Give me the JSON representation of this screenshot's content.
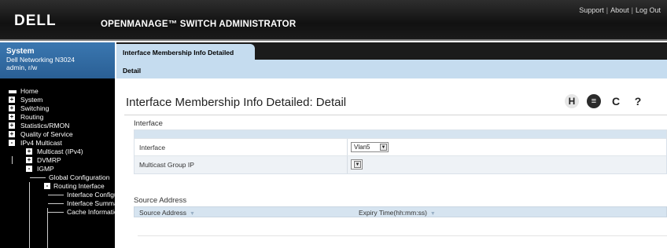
{
  "header": {
    "logo": "DELL",
    "app_title": "OPENMANAGE™ SWITCH ADMINISTRATOR",
    "links": [
      "Support",
      "About",
      "Log Out"
    ]
  },
  "system_box": {
    "title": "System",
    "device": "Dell Networking N3024",
    "user": "admin, r/w"
  },
  "nav": {
    "items": [
      {
        "label": "Home",
        "icon": "home-icon"
      },
      {
        "label": "System",
        "toggle": "+"
      },
      {
        "label": "Switching",
        "toggle": "+"
      },
      {
        "label": "Routing",
        "toggle": "+"
      },
      {
        "label": "Statistics/RMON",
        "toggle": "+"
      },
      {
        "label": "Quality of Service",
        "toggle": "+"
      },
      {
        "label": "IPv4 Multicast",
        "toggle": "-"
      },
      {
        "label": "Multicast (IPv4)",
        "toggle": "+"
      },
      {
        "label": "DVMRP",
        "toggle": "+"
      },
      {
        "label": "IGMP",
        "toggle": "-"
      },
      {
        "label": "Global Configuration"
      },
      {
        "label": "Routing Interface",
        "toggle": "-"
      },
      {
        "label": "Interface Configuration"
      },
      {
        "label": "Interface Summary"
      },
      {
        "label": "Cache Information"
      }
    ]
  },
  "tabs": {
    "active": "Interface Membership Info Detailed",
    "subtab": "Detail"
  },
  "page": {
    "title": "Interface Membership Info Detailed: Detail",
    "tools": {
      "h": "H",
      "print": "≡",
      "refresh": "C",
      "help": "?"
    }
  },
  "interface_section": {
    "label": "Interface",
    "rows": [
      {
        "label": "Interface",
        "value": "Vlan5"
      },
      {
        "label": "Multicast Group IP",
        "value": ""
      }
    ]
  },
  "source_section": {
    "label": "Source Address",
    "columns": [
      "Source Address",
      "Expiry Time(hh:mm:ss)"
    ]
  },
  "colors": {
    "header_bg": "#111111",
    "system_box": "#2f6aa3",
    "tab_active": "#c5dcef",
    "table_head": "#d6e4f0"
  }
}
